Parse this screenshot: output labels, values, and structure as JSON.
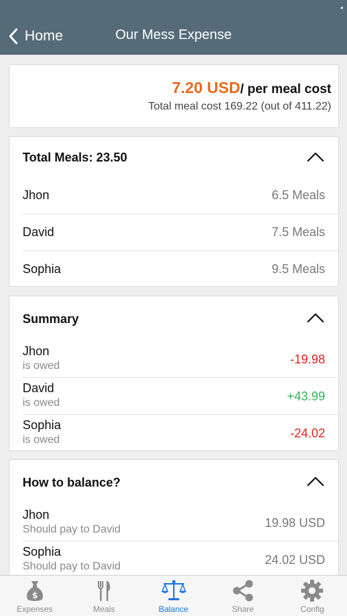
{
  "navbar": {
    "back_label": "Home",
    "title": "Our Mess Expense"
  },
  "cost": {
    "value": "7.20 USD",
    "suffix": "/ per meal cost",
    "subtitle": "Total meal cost 169.22 (out of 411.22)"
  },
  "meals": {
    "title": "Total Meals: 23.50",
    "rows": [
      {
        "name": "Jhon",
        "value": "6.5 Meals"
      },
      {
        "name": "David",
        "value": "7.5 Meals"
      },
      {
        "name": "Sophia",
        "value": "9.5 Meals"
      }
    ]
  },
  "summary": {
    "title": "Summary",
    "rows": [
      {
        "name": "Jhon",
        "sub": "is owed",
        "value": "-19.98"
      },
      {
        "name": "David",
        "sub": "is owed",
        "value": "+43.99"
      },
      {
        "name": "Sophia",
        "sub": "is owed",
        "value": "-24.02"
      }
    ]
  },
  "balance": {
    "title": "How to balance?",
    "rows": [
      {
        "name": "Jhon",
        "sub": "Should pay to David",
        "value": "19.98 USD"
      },
      {
        "name": "Sophia",
        "sub": "Should pay to David",
        "value": "24.02 USD"
      }
    ]
  },
  "tabs": [
    {
      "label": "Expenses",
      "icon": "money-bag-icon",
      "active": false
    },
    {
      "label": "Meals",
      "icon": "fork-knife-icon",
      "active": false
    },
    {
      "label": "Balance",
      "icon": "scale-icon",
      "active": true
    },
    {
      "label": "Share",
      "icon": "share-icon",
      "active": false
    },
    {
      "label": "Config",
      "icon": "gear-icon",
      "active": false
    }
  ],
  "colors": {
    "navbar": "#556b78",
    "accent": "#ea6a1c",
    "negative": "#e0251b",
    "positive": "#2fb45a",
    "tab_active": "#1a73e8"
  }
}
